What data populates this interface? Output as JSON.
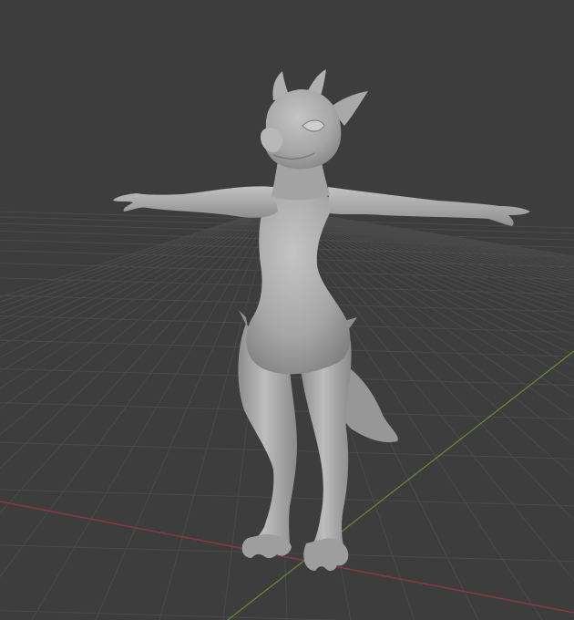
{
  "viewport": {
    "mode": "3d-viewport",
    "shading": "solid",
    "background_color": "#3d3d3d",
    "grid_color": "#4a4a4a",
    "x_axis_color": "#8a3644",
    "y_axis_color": "#6b8a2e"
  },
  "model": {
    "type": "sculpted-character",
    "pose": "t-pose",
    "material_color": "#a9a9a9"
  }
}
